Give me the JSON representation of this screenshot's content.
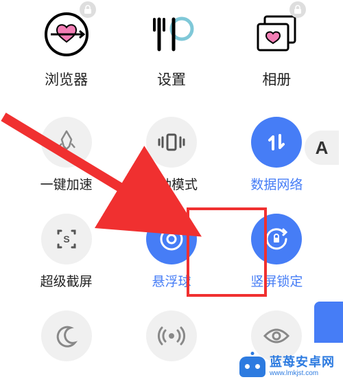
{
  "apps": [
    {
      "label": "浏览器",
      "icon": "heart-target-icon",
      "locked": true
    },
    {
      "label": "设置",
      "icon": "cutlery-icon",
      "locked": false
    },
    {
      "label": "相册",
      "icon": "gallery-heart-icon",
      "locked": true
    }
  ],
  "quick_settings": [
    {
      "label": "一键加速",
      "icon": "rocket-icon",
      "active": false
    },
    {
      "label": "振动模式",
      "icon": "vibrate-icon",
      "active": false
    },
    {
      "label": "数据网络",
      "icon": "data-arrows-icon",
      "active": true
    },
    {
      "label": "超级截屏",
      "icon": "screenshot-icon",
      "active": false
    },
    {
      "label": "悬浮球",
      "icon": "float-ball-icon",
      "active": true
    },
    {
      "label": "竖屏锁定",
      "icon": "rotation-lock-icon",
      "active": true
    },
    {
      "label": "",
      "icon": "moon-icon",
      "active": false
    },
    {
      "label": "",
      "icon": "hotspot-icon",
      "active": false
    },
    {
      "label": "",
      "icon": "eye-icon",
      "active": false
    }
  ],
  "edit_button": {
    "label": "A"
  },
  "annotation": {
    "highlighted_index": 5,
    "arrow_color": "#f03030"
  },
  "watermark": {
    "title": "蓝苺安卓网",
    "url": "www.lmkjst.com"
  }
}
